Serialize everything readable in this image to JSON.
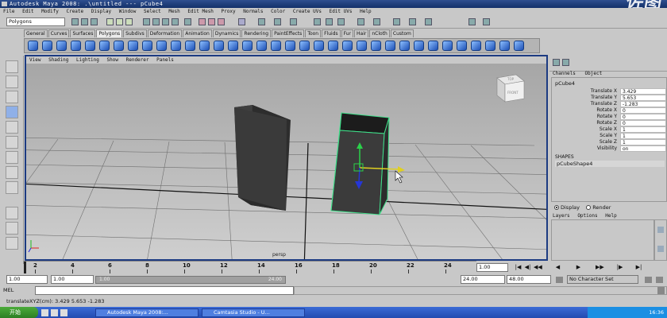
{
  "window": {
    "title": "Autodesk Maya 2008: .\\untitled   ---   pCube4",
    "watermark": "佐图"
  },
  "menubar": [
    "File",
    "Edit",
    "Modify",
    "Create",
    "Display",
    "Window",
    "Select",
    "Mesh",
    "Edit Mesh",
    "Proxy",
    "Normals",
    "Color",
    "Create UVs",
    "Edit UVs",
    "Help"
  ],
  "status": {
    "mode": "Polygons"
  },
  "shelf_tabs": [
    "General",
    "Curves",
    "Surfaces",
    "Polygons",
    "Subdivs",
    "Deformation",
    "Animation",
    "Dynamics",
    "Rendering",
    "PaintEffects",
    "Toon",
    "Fluids",
    "Fur",
    "Hair",
    "nCloth",
    "Custom"
  ],
  "shelf_active": "Polygons",
  "panel_menu": [
    "View",
    "Shading",
    "Lighting",
    "Show",
    "Renderer",
    "Panels"
  ],
  "viewcube": {
    "top": "TOP",
    "front": "FRONT"
  },
  "viewport": {
    "camera": "persp"
  },
  "channel_box": {
    "menu": [
      "Channels",
      "Object"
    ],
    "object": "pCube4",
    "attributes": [
      {
        "label": "Translate X",
        "value": "3.429"
      },
      {
        "label": "Translate Y",
        "value": "5.653"
      },
      {
        "label": "Translate Z",
        "value": "-1.283"
      },
      {
        "label": "Rotate X",
        "value": "0"
      },
      {
        "label": "Rotate Y",
        "value": "0"
      },
      {
        "label": "Rotate Z",
        "value": "0"
      },
      {
        "label": "Scale X",
        "value": "1"
      },
      {
        "label": "Scale Y",
        "value": "1"
      },
      {
        "label": "Scale Z",
        "value": "1"
      },
      {
        "label": "Visibility",
        "value": "on"
      }
    ],
    "shapes_label": "SHAPES",
    "shape": "pCubeShape4"
  },
  "layer_editor": {
    "display": "Display",
    "render": "Render",
    "menu": [
      "Layers",
      "Options",
      "Help"
    ]
  },
  "time_slider": {
    "ticks": [
      "2",
      "4",
      "6",
      "8",
      "10",
      "12",
      "14",
      "16",
      "18",
      "20",
      "22",
      "24"
    ],
    "current": "1.00"
  },
  "range": {
    "start": "1.00",
    "inner_start": "1.00",
    "slider_start": "1.00",
    "slider_end": "24.00",
    "end": "24.00",
    "anim_end": "48.00",
    "character": "No Character Set"
  },
  "mel": {
    "label": "MEL"
  },
  "help_line": "translateXYZ(cm):  3.429      5.653      -1.283",
  "taskbar": {
    "start": "开始",
    "tasks": [
      "Autodesk Maya 2008:...",
      "Camtasia Studio - U..."
    ],
    "clock": "16:36"
  }
}
